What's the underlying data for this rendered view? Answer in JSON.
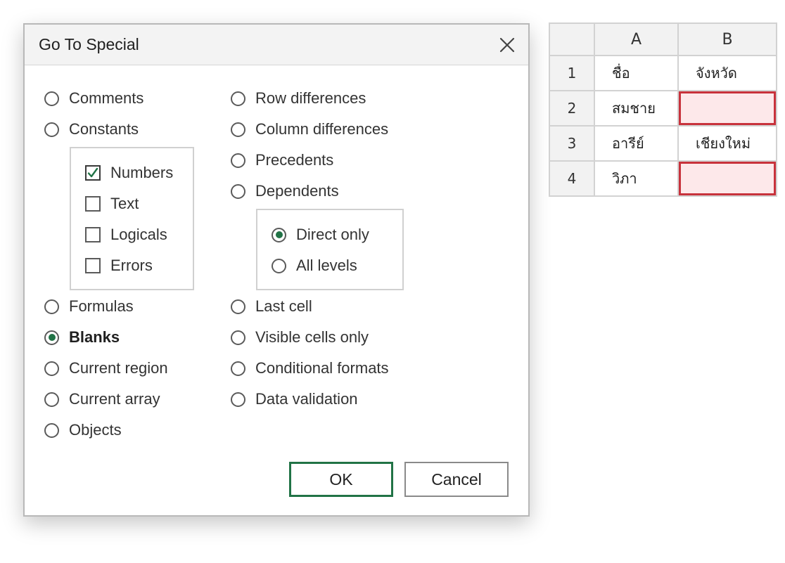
{
  "dialog": {
    "title": "Go To Special",
    "left_options": [
      {
        "label": "Comments",
        "selected": false
      },
      {
        "label": "Constants",
        "selected": false
      },
      {
        "label": "Formulas",
        "selected": false
      },
      {
        "label": "Blanks",
        "selected": true
      },
      {
        "label": "Current region",
        "selected": false
      },
      {
        "label": "Current array",
        "selected": false
      },
      {
        "label": "Objects",
        "selected": false
      }
    ],
    "constants_suboptions": [
      {
        "label": "Numbers",
        "checked": true
      },
      {
        "label": "Text",
        "checked": false
      },
      {
        "label": "Logicals",
        "checked": false
      },
      {
        "label": "Errors",
        "checked": false
      }
    ],
    "right_options": [
      {
        "label": "Row differences",
        "selected": false
      },
      {
        "label": "Column differences",
        "selected": false
      },
      {
        "label": "Precedents",
        "selected": false
      },
      {
        "label": "Dependents",
        "selected": false
      },
      {
        "label": "Last cell",
        "selected": false
      },
      {
        "label": "Visible cells only",
        "selected": false
      },
      {
        "label": "Conditional formats",
        "selected": false
      },
      {
        "label": "Data validation",
        "selected": false
      }
    ],
    "dependents_suboptions": [
      {
        "label": "Direct only",
        "selected": true
      },
      {
        "label": "All levels",
        "selected": false
      }
    ],
    "ok_label": "OK",
    "cancel_label": "Cancel"
  },
  "sheet": {
    "columns": [
      "A",
      "B"
    ],
    "rows": [
      {
        "num": "1",
        "a": "ชื่อ",
        "b": "จังหวัด"
      },
      {
        "num": "2",
        "a": "สมชาย",
        "b": ""
      },
      {
        "num": "3",
        "a": "อารีย์",
        "b": "เชียงใหม่"
      },
      {
        "num": "4",
        "a": "วิภา",
        "b": ""
      }
    ]
  },
  "colors": {
    "accent": "#217346",
    "blank_highlight_fill": "#fde8ea",
    "blank_highlight_border": "#c8323c"
  }
}
